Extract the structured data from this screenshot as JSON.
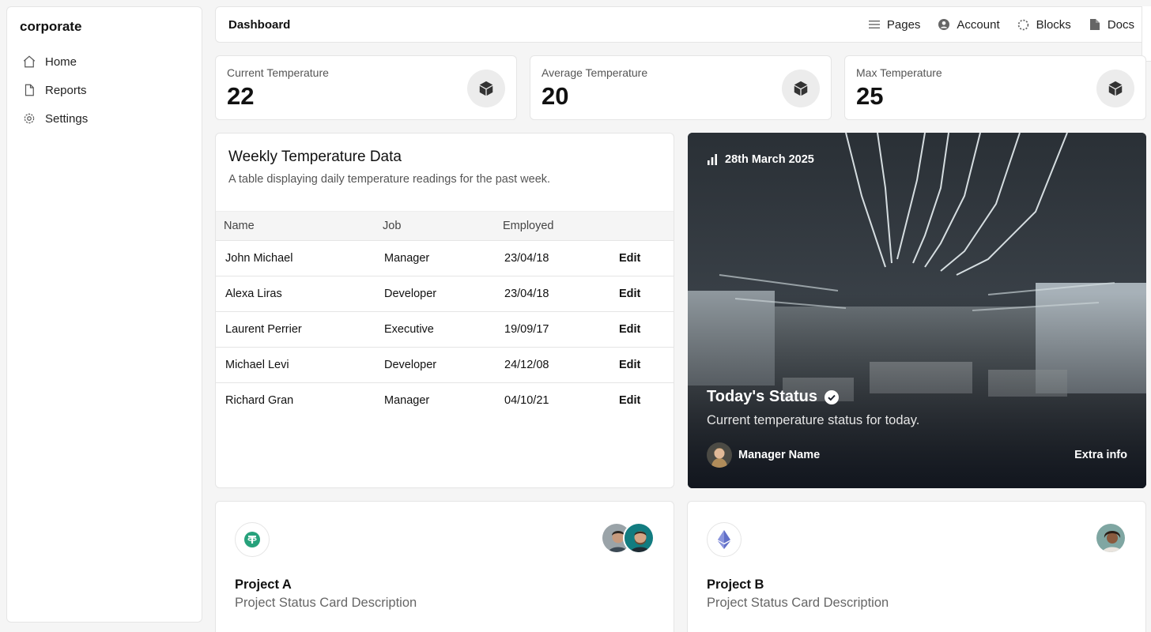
{
  "sidebar": {
    "brand": "corporate",
    "items": [
      {
        "label": "Home",
        "icon": "home-icon"
      },
      {
        "label": "Reports",
        "icon": "document-icon"
      },
      {
        "label": "Settings",
        "icon": "gear-icon"
      }
    ]
  },
  "topbar": {
    "title": "Dashboard",
    "links": [
      {
        "label": "Pages",
        "icon": "list-icon"
      },
      {
        "label": "Account",
        "icon": "user-circle-icon"
      },
      {
        "label": "Blocks",
        "icon": "dashed-circle-icon"
      },
      {
        "label": "Docs",
        "icon": "file-icon"
      }
    ]
  },
  "stats": [
    {
      "label": "Current Temperature",
      "value": "22",
      "icon": "cube-icon"
    },
    {
      "label": "Average Temperature",
      "value": "20",
      "icon": "cube-icon"
    },
    {
      "label": "Max Temperature",
      "value": "25",
      "icon": "cube-icon"
    }
  ],
  "table": {
    "title": "Weekly Temperature Data",
    "description": "A table displaying daily temperature readings for the past week.",
    "columns": [
      "Name",
      "Job",
      "Employed",
      ""
    ],
    "rows": [
      {
        "name": "John Michael",
        "job": "Manager",
        "employed": "23/04/18",
        "action": "Edit"
      },
      {
        "name": "Alexa Liras",
        "job": "Developer",
        "employed": "23/04/18",
        "action": "Edit"
      },
      {
        "name": "Laurent Perrier",
        "job": "Executive",
        "employed": "19/09/17",
        "action": "Edit"
      },
      {
        "name": "Michael Levi",
        "job": "Developer",
        "employed": "24/12/08",
        "action": "Edit"
      },
      {
        "name": "Richard Gran",
        "job": "Manager",
        "employed": "04/10/21",
        "action": "Edit"
      }
    ]
  },
  "hero": {
    "date": "28th March 2025",
    "title": "Today's Status",
    "description": "Current temperature status for today.",
    "manager": "Manager Name",
    "extra": "Extra info"
  },
  "projects": [
    {
      "name": "Project A",
      "description": "Project Status Card Description",
      "logo": "tether-icon",
      "accent": "#26a17b"
    },
    {
      "name": "Project B",
      "description": "Project Status Card Description",
      "logo": "ethereum-icon",
      "accent": "#6270c8"
    }
  ]
}
